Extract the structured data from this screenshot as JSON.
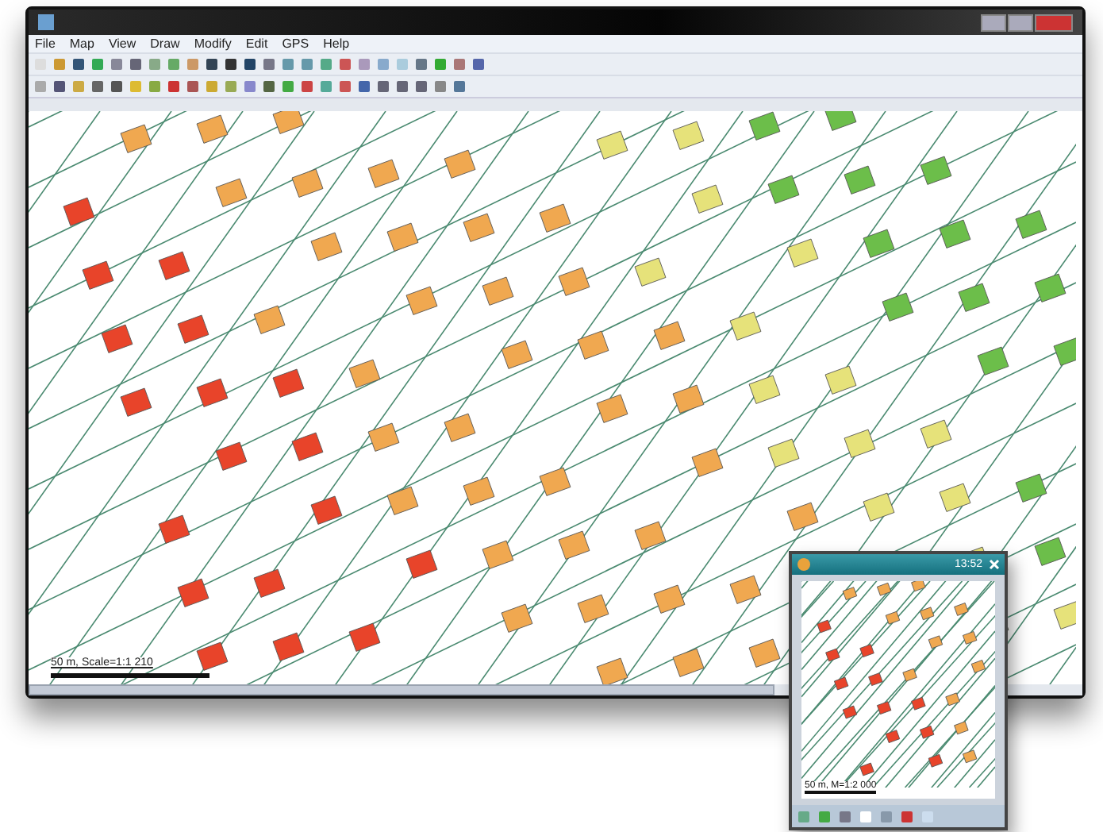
{
  "window": {
    "menu": [
      "File",
      "Map",
      "View",
      "Draw",
      "Modify",
      "Edit",
      "GPS",
      "Help"
    ]
  },
  "map": {
    "scale_label": "50 m, Scale=1:1 210"
  },
  "handheld": {
    "time": "13:52",
    "scale_label": "50 m, M=1:2 000"
  }
}
